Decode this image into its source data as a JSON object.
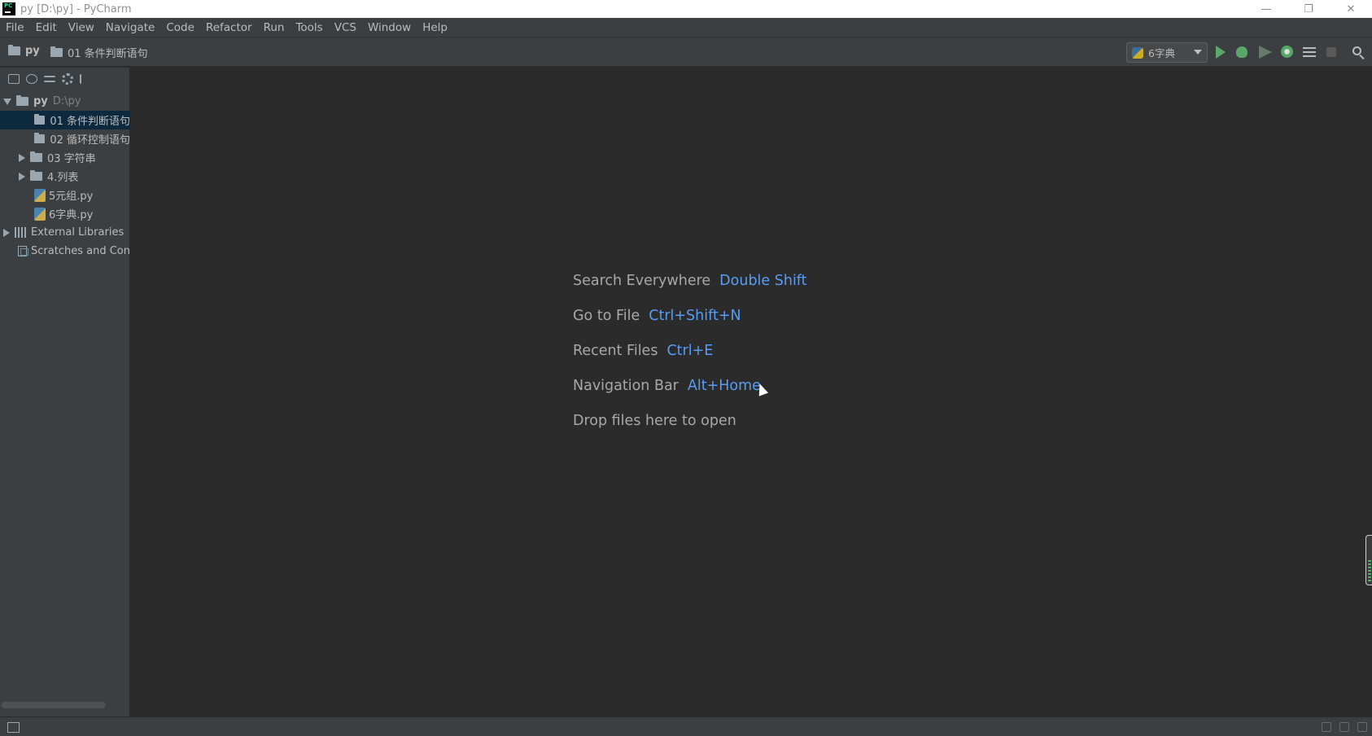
{
  "window": {
    "title": "py [D:\\py] - PyCharm",
    "controls": [
      "—",
      "❐",
      "✕"
    ]
  },
  "menu": [
    "File",
    "Edit",
    "View",
    "Navigate",
    "Code",
    "Refactor",
    "Run",
    "Tools",
    "VCS",
    "Window",
    "Help"
  ],
  "navbar": {
    "project": "py",
    "folder": "01 条件判断语句",
    "run_config": "6字典"
  },
  "tree": {
    "root_name": "py",
    "root_path": "D:\\py",
    "items": [
      {
        "label": "01 条件判断语句",
        "selected": true
      },
      {
        "label": "02 循环控制语句"
      },
      {
        "label": "03 字符串"
      },
      {
        "label": "4.列表"
      },
      {
        "label": "5元组.py"
      },
      {
        "label": "6字典.py"
      },
      {
        "label": "External Libraries"
      },
      {
        "label": "Scratches and Con"
      }
    ]
  },
  "editor": {
    "hints": [
      {
        "label": "Search Everywhere",
        "shortcut": "Double Shift"
      },
      {
        "label": "Go to File",
        "shortcut": "Ctrl+Shift+N"
      },
      {
        "label": "Recent Files",
        "shortcut": "Ctrl+E"
      },
      {
        "label": "Navigation Bar",
        "shortcut": "Alt+Home"
      }
    ],
    "drop_text": "Drop files here to open"
  },
  "colors": {
    "background": "#2b2b2b",
    "panel": "#3c3f41",
    "selection": "#0d293e",
    "shortcut": "#589df6",
    "run_green": "#59a869"
  }
}
